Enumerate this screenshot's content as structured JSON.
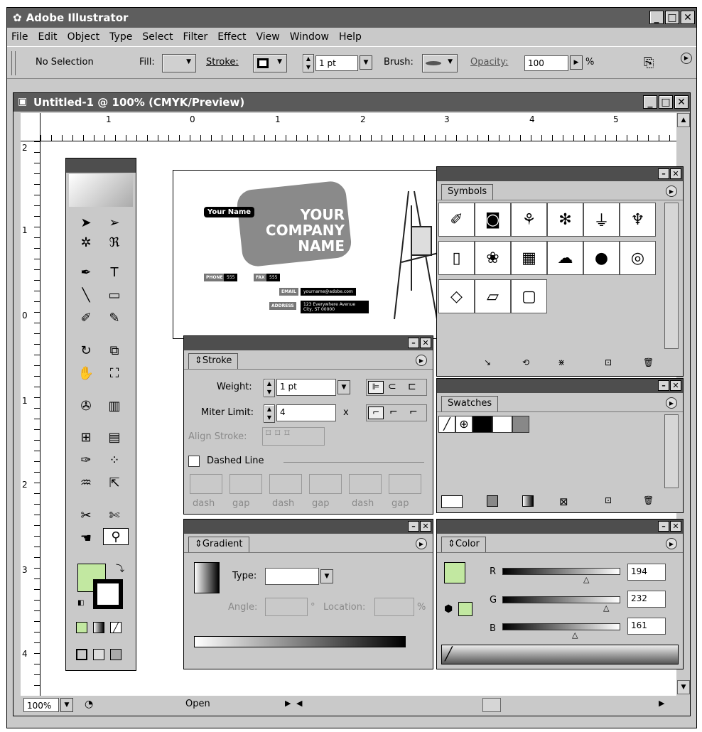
{
  "app": {
    "title": "Adobe Illustrator"
  },
  "menu": [
    "File",
    "Edit",
    "Object",
    "Type",
    "Select",
    "Filter",
    "Effect",
    "View",
    "Window",
    "Help"
  ],
  "control": {
    "selection": "No Selection",
    "fill": "Fill:",
    "stroke": "Stroke:",
    "weight": "1 pt",
    "brush": "Brush:",
    "opacity": "Opacity:",
    "opacity_value": "100",
    "percent": "%"
  },
  "document": {
    "title": "Untitled-1 @ 100% (CMYK/Preview)",
    "zoom": "100%",
    "status": "Open"
  },
  "ruler": {
    "h": [
      "1",
      "0",
      "1",
      "2",
      "3",
      "4",
      "5"
    ],
    "v": [
      "2",
      "1",
      "0",
      "1",
      "2",
      "3",
      "4"
    ]
  },
  "artwork": {
    "your_name": "Your Name",
    "company": "YOUR COMPANY NAME",
    "phone": "PHONE",
    "fax": "FAX",
    "email_label": "EMAIL",
    "email": "yourname@adobe.com",
    "address_label": "ADDRESS",
    "address": "123 Everywhere Avenue City, ST 00000",
    "digits": "555"
  },
  "stroke": {
    "tab": "Stroke",
    "weight_label": "Weight:",
    "weight": "1 pt",
    "miter_label": "Miter Limit:",
    "miter": "4",
    "x": "x",
    "align": "Align Stroke:",
    "dashed": "Dashed Line",
    "dash_labels": [
      "dash",
      "gap",
      "dash",
      "gap",
      "dash",
      "gap"
    ]
  },
  "symbols": {
    "tab": "Symbols"
  },
  "swatches": {
    "tab": "Swatches"
  },
  "gradient": {
    "tab": "Gradient",
    "type_label": "Type:",
    "angle_label": "Angle:",
    "degree": "°",
    "location_label": "Location:",
    "percent": "%"
  },
  "color": {
    "tab": "Color",
    "r_label": "R",
    "r": "194",
    "g_label": "G",
    "g": "232",
    "b_label": "B",
    "b": "161"
  }
}
